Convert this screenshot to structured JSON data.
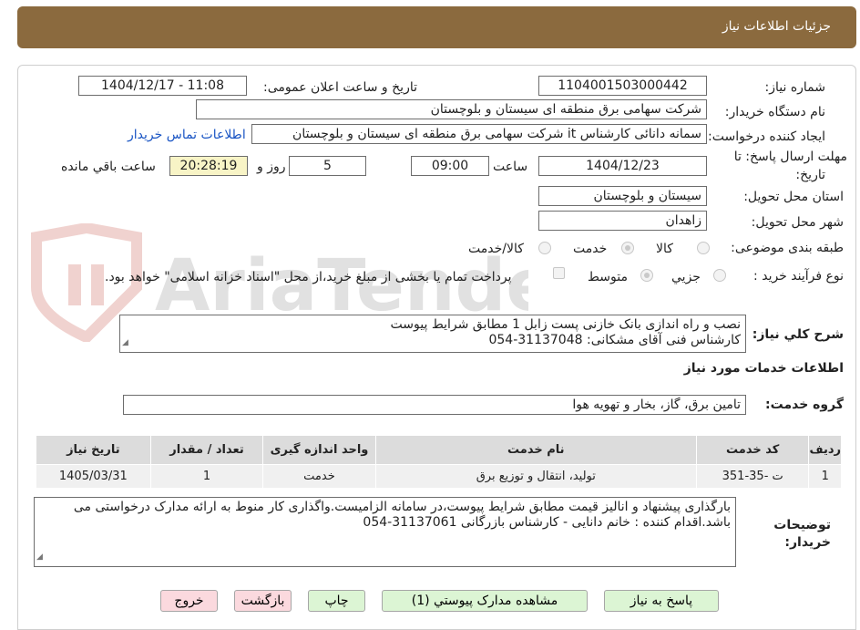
{
  "header": {
    "title": "جزئیات اطلاعات نیاز"
  },
  "fields": {
    "need_number_label": "شماره نیاز:",
    "need_number": "1104001503000442",
    "announce_label": "تاریخ و ساعت اعلان عمومی:",
    "announce_value": "1404/12/17 - 11:08",
    "buyer_org_label": "نام دستگاه خریدار:",
    "buyer_org": "شرکت سهامی برق منطقه ای سیستان و بلوچستان",
    "requester_label": "ایجاد کننده درخواست:",
    "requester": "سمانه دانائی کارشناس it شرکت سهامی برق منطقه ای سیستان و بلوچستان",
    "contact_link": "اطلاعات تماس خریدار",
    "deadline_label_1": "مهلت ارسال پاسخ: تا",
    "deadline_label_2": "تاریخ:",
    "deadline_date": "1404/12/23",
    "time_label": "ساعت",
    "deadline_time": "09:00",
    "days": "5",
    "days_label": "روز و",
    "remaining": "20:28:19",
    "remaining_label": "ساعت باقي مانده",
    "province_label": "استان محل تحویل:",
    "province": "سیستان و بلوچستان",
    "city_label": "شهر محل تحویل:",
    "city": "زاهدان",
    "category_label": "طبقه بندی موضوعی:",
    "category_options": [
      "کالا",
      "خدمت",
      "کالا/خدمت"
    ],
    "process_label": "نوع فرآیند خرید :",
    "process_options": [
      "جزیي",
      "متوسط"
    ],
    "payment_note": "پرداخت تمام یا بخشی از مبلغ خرید،از محل \"اسناد خزانه اسلامی\" خواهد بود."
  },
  "summary": {
    "label": "شرح کلي نیاز:",
    "line1": "نصب و راه اندازی بانک خازنی پست زابل 1 مطابق شرایط پیوست",
    "line2": "کارشناس فنی آقای مشکانی: 31137048-054"
  },
  "services": {
    "title": "اطلاعات خدمات مورد نیاز",
    "group_label": "گروه خدمت:",
    "group_value": "تامین برق، گاز، بخار و تهویه هوا",
    "table": {
      "headers": [
        "ردیف",
        "کد خدمت",
        "نام خدمت",
        "واحد اندازه گیری",
        "تعداد / مقدار",
        "تاریخ نیاز"
      ],
      "rows": [
        [
          "1",
          "ت -35-351",
          "تولید، انتقال و توزیع برق",
          "خدمت",
          "1",
          "1405/03/31"
        ]
      ]
    }
  },
  "notes": {
    "label_1": "توضیحات",
    "label_2": "خریدار:",
    "line1": "بارگذاری پیشنهاد و انالیز قیمت مطابق شرایط پیوست،در سامانه الزامیست.واگذاری کار منوط به ارائه مدارک درخواستی می",
    "line2": "باشد.اقدام کننده : خانم دانایی - کارشناس بازرگانی 31137061-054"
  },
  "buttons": {
    "reply": "پاسخ به نیاز",
    "view_docs": "مشاهده مدارک پیوستي (1)",
    "print": "چاپ",
    "back": "بازگشت",
    "exit": "خروج"
  },
  "watermark": {
    "text": "AriaTender.neT"
  },
  "colors": {
    "header_bg": "#8b6a3e",
    "link": "#1a55c4",
    "green_btn": "#dcf5d4",
    "pink_btn": "#fbd9de"
  }
}
